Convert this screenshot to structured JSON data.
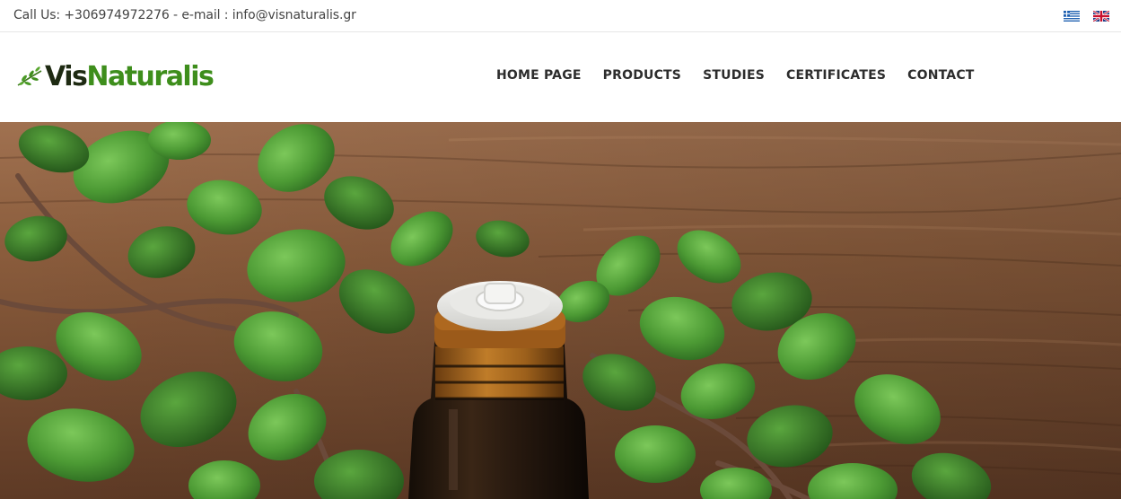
{
  "topbar": {
    "contact": "Call Us: +306974972276 - e-mail : info@visnaturalis.gr",
    "languages": [
      {
        "code": "el",
        "icon": "greek-flag-icon"
      },
      {
        "code": "en",
        "icon": "uk-flag-icon"
      }
    ]
  },
  "brand": {
    "name_part1": "Vis",
    "name_part2": "Naturalis",
    "icon": "leaf-sprig-icon",
    "colors": {
      "dark": "#1e2a12",
      "green": "#3e8e1c"
    }
  },
  "nav": {
    "items": [
      {
        "label": "HOME PAGE"
      },
      {
        "label": "PRODUCTS"
      },
      {
        "label": "STUDIES"
      },
      {
        "label": "CERTIFICATES"
      },
      {
        "label": "CONTACT"
      }
    ]
  },
  "hero": {
    "image": "oregano-essential-oil-bottle-photo",
    "colors": {
      "wood": "#7b4f33",
      "leaf": "#4e9a3a",
      "bottle": "#2a1d12",
      "oil": "#b5701f"
    }
  }
}
